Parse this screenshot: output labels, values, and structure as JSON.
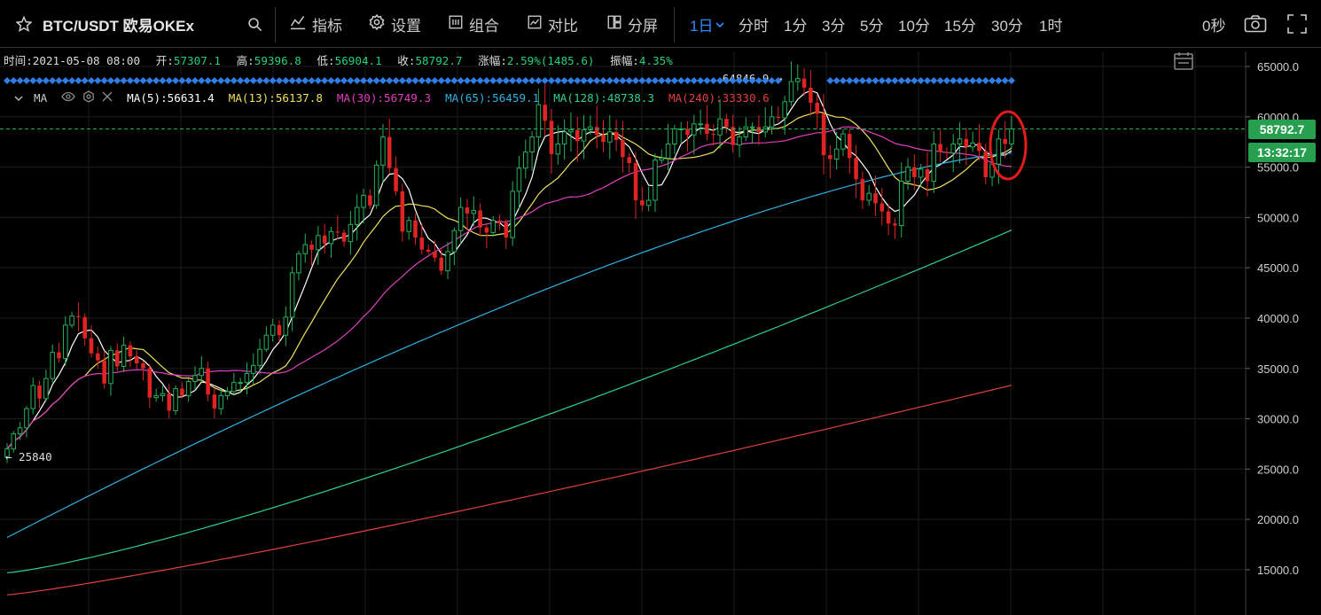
{
  "toolbar": {
    "symbol": "BTC/USDT 欧易OKEx",
    "indicators_label": "指标",
    "settings_label": "设置",
    "combo_label": "组合",
    "compare_label": "对比",
    "split_label": "分屏",
    "intervals": [
      "1日",
      "分时",
      "1分",
      "3分",
      "5分",
      "10分",
      "15分",
      "30分",
      "1时"
    ],
    "active_interval": "1日",
    "refresh_label": "0秒"
  },
  "ohlc": {
    "time_label": "时间:",
    "time": "2021-05-08 08:00",
    "open_label": "开:",
    "open": "57307.1",
    "high_label": "高:",
    "high": "59396.8",
    "low_label": "低:",
    "low": "56904.1",
    "close_label": "收:",
    "close": "58792.7",
    "change_label": "涨幅:",
    "change": "2.59%(1485.6)",
    "amplitude_label": "振幅:",
    "amplitude": "4.35%"
  },
  "ma_legend": {
    "name": "MA",
    "items": [
      {
        "text": "MA(5):56631.4",
        "color": "#ffffff"
      },
      {
        "text": "MA(13):56137.8",
        "color": "#f0e060"
      },
      {
        "text": "MA(30):56749.3",
        "color": "#e040c0"
      },
      {
        "text": "MA(65):56459.1",
        "color": "#30b0e0"
      },
      {
        "text": "MA(128):48738.3",
        "color": "#30d090"
      },
      {
        "text": "MA(240):33330.6",
        "color": "#e04040"
      }
    ]
  },
  "chart_data": {
    "type": "candlestick",
    "symbol": "BTC/USDT",
    "interval": "1D",
    "y_ticks": [
      15000,
      20000,
      25000,
      30000,
      35000,
      40000,
      45000,
      50000,
      55000,
      60000,
      65000
    ],
    "ylim": [
      10500,
      66500
    ],
    "last_price": 58792.7,
    "countdown": "13:32:17",
    "high_marker": {
      "label": "64846.9 →",
      "value": 64846.9
    },
    "low_marker": {
      "label": "← 25840",
      "value": 25840
    },
    "colors": {
      "up": "#26b05a",
      "down": "#e02424"
    },
    "closes": [
      27000,
      28500,
      29100,
      31000,
      33300,
      32000,
      34000,
      36600,
      36000,
      39300,
      40200,
      40100,
      38000,
      36500,
      35800,
      33500,
      36800,
      35200,
      37300,
      36200,
      35500,
      35000,
      32100,
      32300,
      32500,
      30800,
      33000,
      32300,
      33700,
      34300,
      35000,
      32400,
      31000,
      32300,
      32700,
      33600,
      33600,
      34500,
      35300,
      36900,
      38300,
      39300,
      38300,
      40100,
      44500,
      46400,
      47300,
      46800,
      48200,
      47400,
      48600,
      48500,
      47600,
      49300,
      51000,
      52200,
      51200,
      55200,
      58000,
      54900,
      52600,
      48600,
      49700,
      48000,
      46800,
      46600,
      46000,
      44700,
      46600,
      48700,
      51000,
      50400,
      50700,
      49000,
      48500,
      49700,
      49500,
      48000,
      52600,
      54900,
      56500,
      58000,
      61200,
      59600,
      56300,
      57300,
      58500,
      58700,
      57600,
      58700,
      59000,
      58200,
      57500,
      58500,
      57700,
      56000,
      55400,
      51700,
      51200,
      51700,
      55700,
      55900,
      57300,
      58800,
      58800,
      58200,
      59300,
      59300,
      58300,
      58200,
      59800,
      59000,
      57200,
      58000,
      59000,
      59000,
      58500,
      59000,
      60000,
      59900,
      61500,
      63500,
      63800,
      62900,
      61400,
      60300,
      56200,
      55800,
      56800,
      58300,
      55900,
      53800,
      51700,
      52400,
      51400,
      50600,
      49400,
      49200,
      53600,
      55000,
      54000,
      54800,
      53600,
      57300,
      56500,
      56400,
      57300,
      57800,
      57000,
      57400,
      56600,
      54000,
      55300,
      57800,
      57300,
      58792.7
    ]
  }
}
